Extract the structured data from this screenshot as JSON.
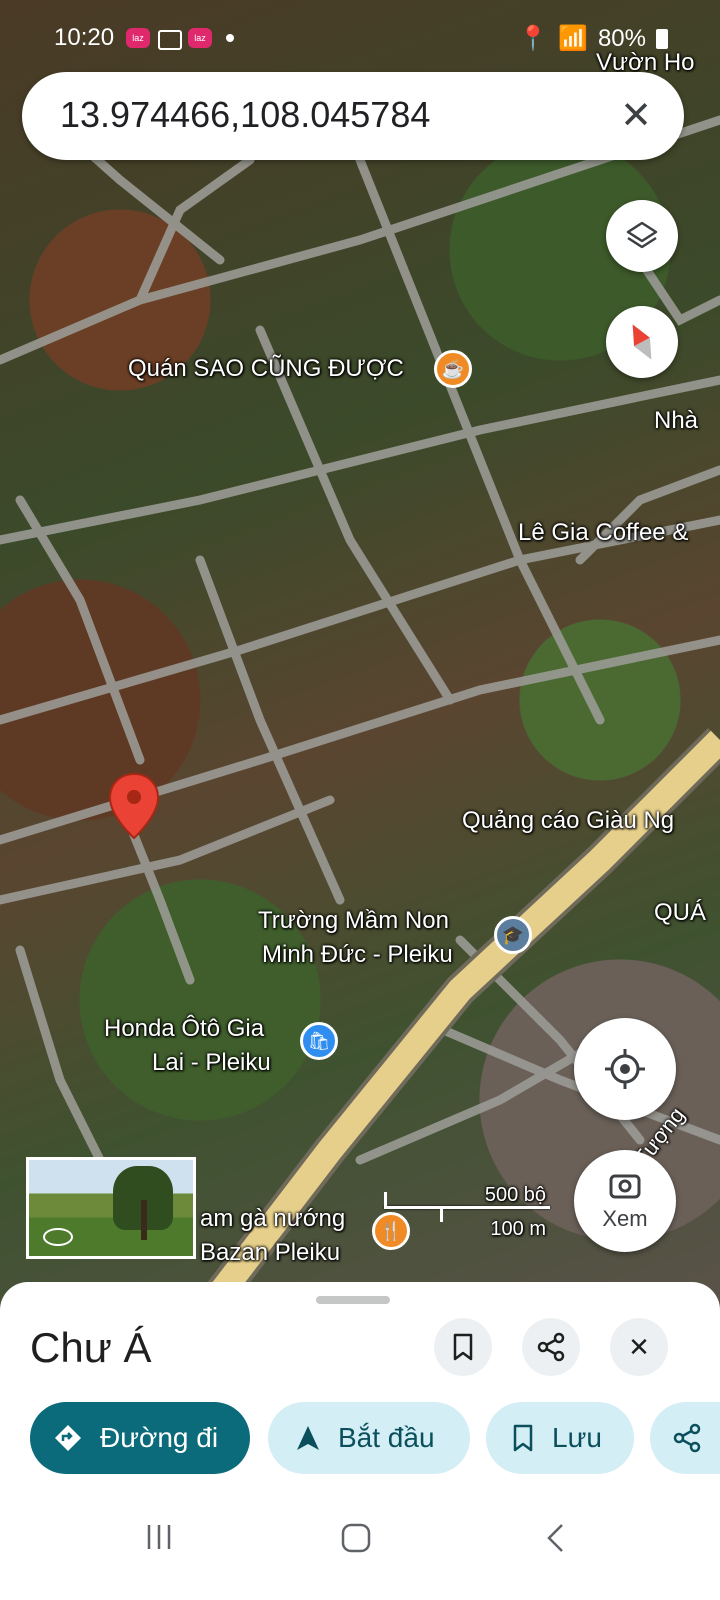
{
  "status_bar": {
    "time": "10:20",
    "app_icon_label": "laz",
    "battery": "80%"
  },
  "search": {
    "query": "13.974466,108.045784",
    "close_icon": "close-icon"
  },
  "map": {
    "labels": {
      "top_right": "Vườn Ho",
      "cafe": "Quán SAO CŨNG ĐƯỢC",
      "nha": "Nhà",
      "coffee": "Lê Gia Coffee &",
      "ad": "Quảng cáo Giàu Ng",
      "school_line1": "Trường Mầm Non",
      "school_line2": "Minh Đức - Pleiku",
      "qua": "QUÁ",
      "honda_line1": "Honda Ôtô Gia",
      "honda_line2": "Lai - Pleiku",
      "restaurant_line1": "am gà nướng",
      "restaurant_line2": "Bazan Pleiku",
      "street": "Tượng"
    },
    "scale": {
      "imperial": "500 bộ",
      "metric": "100 m"
    },
    "view_button_label": "Xem",
    "colors": {
      "pin": "#ea4335",
      "cafe_poi": "#f08a24",
      "school_poi": "#5c7e9e",
      "shop_poi": "#2f8ef0",
      "restaurant_poi": "#f08a24",
      "main_road": "#e6cf8a"
    }
  },
  "sheet": {
    "title": "Chư Á",
    "chips": {
      "directions": "Đường đi",
      "start": "Bắt đầu",
      "save": "Lưu"
    },
    "colors": {
      "primary": "#0b6b7a",
      "chip_bg": "#d3eef5"
    }
  }
}
